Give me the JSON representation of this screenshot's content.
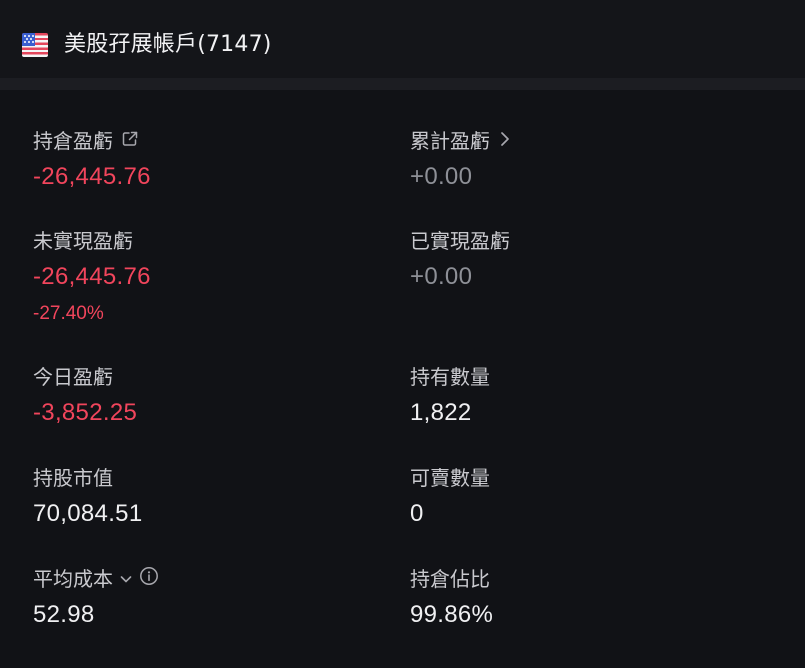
{
  "header": {
    "flag_icon": "us-flag-icon",
    "title": "美股孖展帳戶(7147)"
  },
  "colors": {
    "negative": "#f1455c",
    "neutral_zero": "#8e9097",
    "background": "#111216"
  },
  "metrics": {
    "position_pnl": {
      "label": "持倉盈虧",
      "value": "-26,445.76",
      "icon": "share-export-icon"
    },
    "cumulative_pnl": {
      "label": "累計盈虧",
      "value": "+0.00",
      "icon": "chevron-right-icon"
    },
    "unrealized_pnl": {
      "label": "未實現盈虧",
      "value": "-26,445.76",
      "percent": "-27.40%"
    },
    "realized_pnl": {
      "label": "已實現盈虧",
      "value": "+0.00"
    },
    "today_pnl": {
      "label": "今日盈虧",
      "value": "-3,852.25"
    },
    "holding_qty": {
      "label": "持有數量",
      "value": "1,822"
    },
    "market_value": {
      "label": "持股市值",
      "value": "70,084.51"
    },
    "sellable_qty": {
      "label": "可賣數量",
      "value": "0"
    },
    "avg_cost": {
      "label": "平均成本",
      "value": "52.98",
      "icons": [
        "chevron-down-icon",
        "info-icon"
      ]
    },
    "position_ratio": {
      "label": "持倉佔比",
      "value": "99.86%"
    }
  }
}
